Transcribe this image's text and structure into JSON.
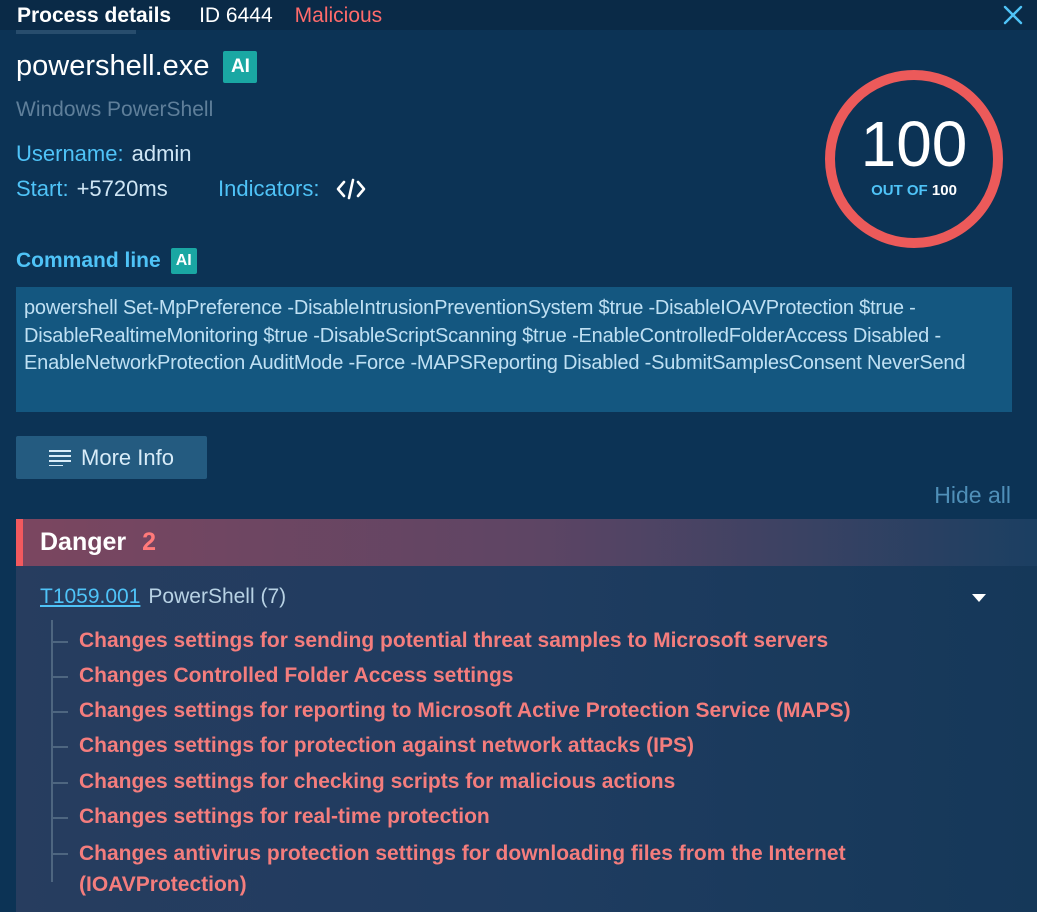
{
  "titlebar": {
    "title": "Process details",
    "id_label": "ID 6444",
    "status": "Malicious",
    "close_icon": "close-icon"
  },
  "process": {
    "name": "powershell.exe",
    "ai_badge": "AI",
    "description": "Windows PowerShell",
    "username_label": "Username:",
    "username": "admin",
    "start_label": "Start:",
    "start": "+5720ms",
    "indicators_label": "Indicators:",
    "indicators_icon": "code-icon"
  },
  "score": {
    "value": "100",
    "out_of_label": "OUT OF",
    "max": "100",
    "color": "#ec5a5a"
  },
  "command": {
    "label": "Command line",
    "ai_badge": "AI",
    "text": "powershell Set-MpPreference -DisableIntrusionPreventionSystem $true -DisableIOAVProtection $true -DisableRealtimeMonitoring $true -DisableScriptScanning $true -EnableControlledFolderAccess Disabled -EnableNetworkProtection AuditMode -Force -MAPSReporting Disabled -SubmitSamplesConsent NeverSend"
  },
  "actions": {
    "more_info": "More Info",
    "more_info_icon": "list-icon",
    "hide_all": "Hide all"
  },
  "danger": {
    "label": "Danger",
    "count": "2",
    "accent": "#f2595e",
    "technique": {
      "id": "T1059.001",
      "name": "PowerShell (7)",
      "expand_icon": "caret-down-icon"
    },
    "indicators": [
      "Changes settings for sending potential threat samples to Microsoft servers",
      "Changes Controlled Folder Access settings",
      "Changes settings for reporting to Microsoft Active Protection Service (MAPS)",
      "Changes settings for protection against network attacks (IPS)",
      "Changes settings for checking scripts for malicious actions",
      "Changes settings for real-time protection",
      "Changes antivirus protection settings for downloading files from the Internet (IOAVProtection)"
    ]
  }
}
